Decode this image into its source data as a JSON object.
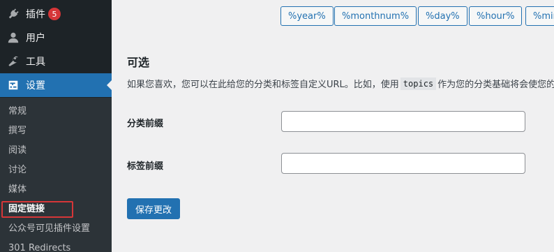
{
  "sidebar": {
    "menu": {
      "plugins": {
        "label": "插件",
        "badge": "5",
        "icon": "plugin-icon"
      },
      "users": {
        "label": "用户",
        "icon": "user-icon"
      },
      "tools": {
        "label": "工具",
        "icon": "wrench-icon"
      },
      "settings": {
        "label": "设置",
        "icon": "settings-icon"
      }
    },
    "submenu": [
      {
        "label": "常规"
      },
      {
        "label": "撰写"
      },
      {
        "label": "阅读"
      },
      {
        "label": "讨论"
      },
      {
        "label": "媒体"
      },
      {
        "label": "固定链接",
        "current": true
      },
      {
        "label": "公众号可见插件设置"
      },
      {
        "label": "301 Redirects"
      }
    ]
  },
  "main": {
    "tags": [
      "%year%",
      "%monthnum%",
      "%day%",
      "%hour%",
      "%min"
    ],
    "optional": {
      "title": "可选",
      "desc_before": "如果您喜欢，您可以在此给您的分类和标签自定义URL。比如，使用",
      "desc_code": "topics",
      "desc_after": "作为您的分类基础将会使您的"
    },
    "fields": {
      "category_base": {
        "label": "分类前缀",
        "value": ""
      },
      "tag_base": {
        "label": "标签前缀",
        "value": ""
      }
    },
    "save_label": "保存更改"
  },
  "colors": {
    "accent": "#2271b1",
    "sidebar_bg": "#1d2327",
    "submenu_bg": "#2c3338",
    "badge": "#d63638",
    "highlight": "#d63638"
  }
}
